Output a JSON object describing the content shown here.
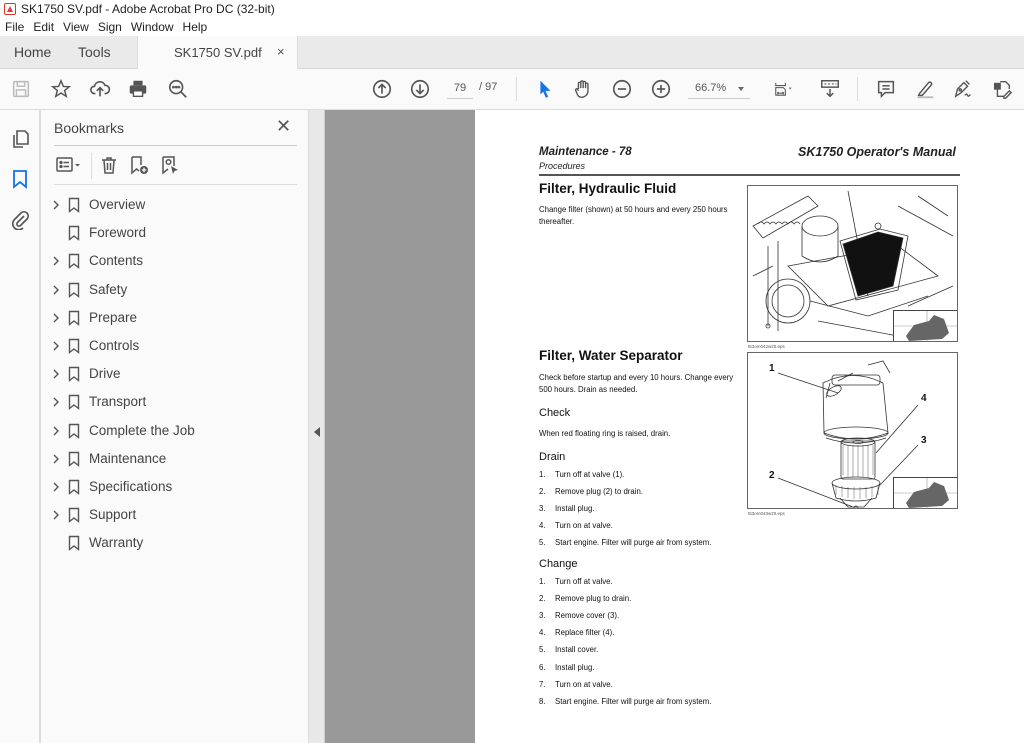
{
  "window": {
    "title": "SK1750 SV.pdf - Adobe Acrobat Pro DC (32-bit)",
    "icon": "acrobat-pdf-icon"
  },
  "menu": [
    "File",
    "Edit",
    "View",
    "Sign",
    "Window",
    "Help"
  ],
  "tabs": {
    "home": "Home",
    "tools": "Tools",
    "document": "SK1750 SV.pdf",
    "close": "×"
  },
  "toolbar": {
    "left_icons": [
      "save-icon",
      "bookmark-star-icon",
      "upload-cloud-icon",
      "print-icon",
      "search-zoom-icon"
    ],
    "page_current": "79",
    "page_total": "/ 97",
    "zoom": "66.7%",
    "right_icons": [
      "select-cursor-icon",
      "hand-icon",
      "zoom-out-icon",
      "zoom-in-icon",
      "page-fit-icon",
      "scroll-mode-icon",
      "comment-icon",
      "highlight-icon",
      "sign-icon",
      "edit-share-icon"
    ]
  },
  "bookmarks": {
    "title": "Bookmarks",
    "close": "✕",
    "tools": [
      "options-menu-icon",
      "delete-bookmark-icon",
      "new-bookmark-icon",
      "find-bookmark-icon"
    ],
    "items": [
      {
        "label": "Overview",
        "expandable": true
      },
      {
        "label": "Foreword",
        "expandable": false
      },
      {
        "label": "Contents",
        "expandable": true
      },
      {
        "label": "Safety",
        "expandable": true
      },
      {
        "label": "Prepare",
        "expandable": true
      },
      {
        "label": "Controls",
        "expandable": true
      },
      {
        "label": "Drive",
        "expandable": true
      },
      {
        "label": "Transport",
        "expandable": true
      },
      {
        "label": "Complete the Job",
        "expandable": true
      },
      {
        "label": "Maintenance",
        "expandable": true
      },
      {
        "label": "Specifications",
        "expandable": true
      },
      {
        "label": "Support",
        "expandable": true
      },
      {
        "label": "Warranty",
        "expandable": false
      }
    ]
  },
  "document": {
    "header_left": "Maintenance - 78",
    "header_sub": "Procedures",
    "header_right": "SK1750 Operator's Manual",
    "section1": {
      "title": "Filter, Hydraulic Fluid",
      "body": "Change filter (shown) at 50 hours and every 250 hours thereafter.",
      "caption": "t53om042w20.eps"
    },
    "section2": {
      "title": "Filter, Water Separator",
      "body": "Check before startup and every 10 hours. Change every 500 hours. Drain as needed.",
      "caption": "t53om043w20.eps",
      "callouts": [
        "1",
        "2",
        "3",
        "4"
      ],
      "check_title": "Check",
      "check_body": "When red floating ring is raised, drain.",
      "drain_title": "Drain",
      "drain_steps": [
        "Turn off at valve (1).",
        "Remove plug (2) to drain.",
        "Install plug.",
        "Turn on at valve.",
        "Start engine. Filter will purge air from system."
      ],
      "change_title": "Change",
      "change_steps": [
        "Turn off at valve.",
        "Remove plug to drain.",
        "Remove cover (3).",
        "Replace filter (4).",
        "Install cover.",
        "Install plug.",
        "Turn on at valve.",
        "Start engine. Filter will purge air from system."
      ]
    }
  },
  "colors": {
    "accent": "#1473e6",
    "viewer_bg": "#999999"
  }
}
